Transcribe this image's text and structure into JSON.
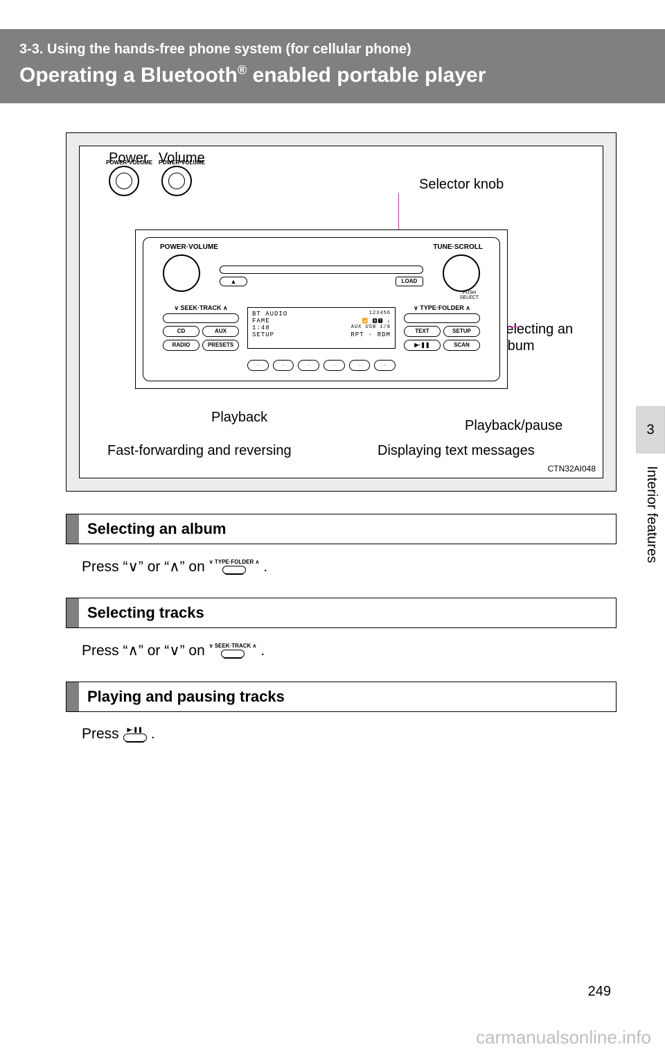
{
  "header": {
    "section_number": "3-3. Using the hands-free phone system (for cellular phone)",
    "title_pre": "Operating a Bluetooth",
    "title_sup": "®",
    "title_post": " enabled portable player"
  },
  "diagram": {
    "labels": {
      "power": "Power",
      "volume": "Volume",
      "power_volume_small": "POWER·VOLUME",
      "selector_knob": "Selector knob",
      "selecting_album": "Selecting an album",
      "playback_pause": "Playback/pause",
      "playback": "Playback",
      "fast_fwd": "Fast-forwarding and reversing",
      "displaying_text": "Displaying text messages"
    },
    "stereo": {
      "power_volume": "POWER·VOLUME",
      "tune_scroll": "TUNE·SCROLL",
      "push_select": "PUSH\nSELECT",
      "eject": "▲",
      "load": "LOAD",
      "seek_track": "∨ SEEK·TRACK ∧",
      "type_folder": "∨ TYPE·FOLDER ∧",
      "left_buttons": [
        [
          "CD",
          "AUX"
        ],
        [
          "RADIO",
          "PRESETS"
        ]
      ],
      "right_buttons": [
        [
          "TEXT",
          "SETUP"
        ],
        [
          "▶·❚❚",
          "SCAN"
        ]
      ],
      "display": {
        "line1_left": "BT AUDIO",
        "line1_right": "123456",
        "line2_left": "FAME",
        "line2_right_icons": "📶 🅱🆃 ♪",
        "line3_left": "1:48",
        "line3_right": "AUX USB   1/8",
        "line4_left": "SETUP",
        "line4_right": "RPT · RDM"
      },
      "presets": [
        "·",
        "·",
        "·",
        "·",
        "·",
        "·"
      ]
    },
    "reference": "CTN32AI048"
  },
  "side": {
    "chapter_num": "3",
    "chapter_label": "Interior features"
  },
  "sections": {
    "selecting_album": {
      "heading": "Selecting an album",
      "text_pre": "Press “∨” or “∧” on ",
      "btn_label": "∨ TYPE·FOLDER ∧",
      "text_post": "."
    },
    "selecting_tracks": {
      "heading": "Selecting tracks",
      "text_pre": "Press “∧” or “∨” on ",
      "btn_label": "∨ SEEK·TRACK ∧",
      "text_post": "."
    },
    "playing_pausing": {
      "heading": "Playing and pausing tracks",
      "text_pre": "Press ",
      "btn_label": "▶·❚❚",
      "text_post": "."
    }
  },
  "page_number": "249",
  "watermark": "carmanualsonline.info"
}
